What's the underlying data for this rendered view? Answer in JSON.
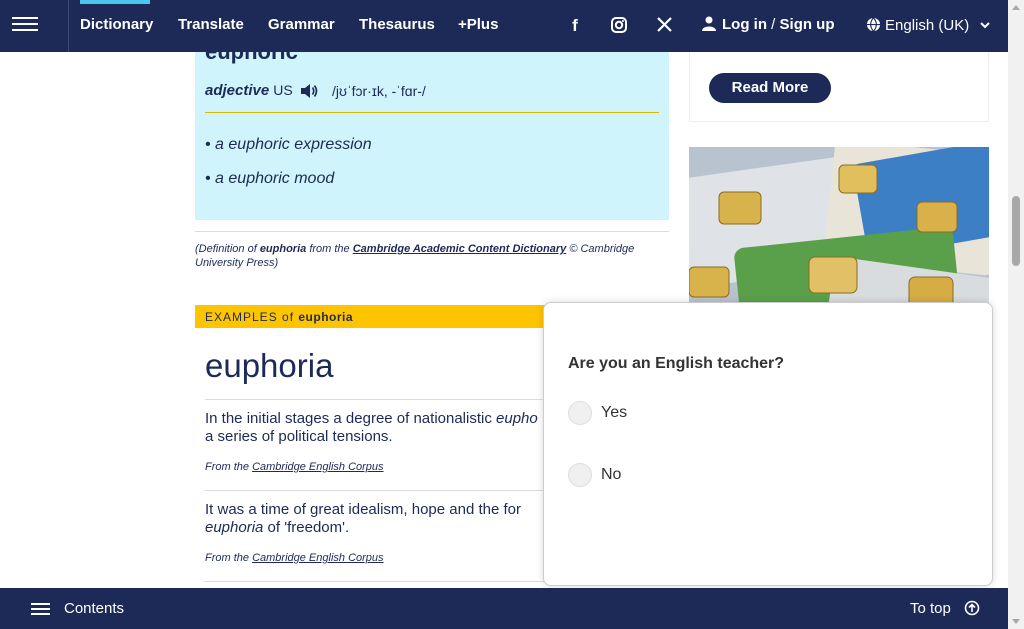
{
  "nav": {
    "items": [
      {
        "label": "Dictionary"
      },
      {
        "label": "Translate"
      },
      {
        "label": "Grammar"
      },
      {
        "label": "Thesaurus"
      },
      {
        "label": "+Plus"
      }
    ],
    "social": [
      "facebook-icon",
      "instagram-icon",
      "x-icon"
    ],
    "login_label": "Log in",
    "login_sep": "/",
    "signup_label": "Sign up",
    "language": "English (UK)"
  },
  "entry": {
    "headword": "euphoric",
    "pos": "adjective",
    "region": "US",
    "ipa": "/jʊˈfɔr·ɪk, -ˈfɑr-/",
    "examples": [
      {
        "prefix": "a euphoric ",
        "link": "expression"
      },
      {
        "prefix": "a euphoric ",
        "link": "mood"
      }
    ],
    "citation": {
      "pre": "(Definition of ",
      "word": "euphoria",
      "mid": " from the ",
      "source": "Cambridge Academic Content Dictionary",
      "post": " © Cambridge University Press)"
    }
  },
  "examples_section": {
    "band_label": "EXAMPLES of ",
    "band_word": "euphoria",
    "title": "euphoria",
    "items": [
      {
        "pre": "In the initial stages a degree of nationalistic ",
        "em": "eupho",
        "post": " a series of political tensions.",
        "from": "From the ",
        "source": "Cambridge English Corpus"
      },
      {
        "pre": "It was a time of great idealism, hope and the for",
        "em": "euphoria",
        "post": " of 'freedom'.",
        "from": "From the ",
        "source": "Cambridge English Corpus"
      }
    ]
  },
  "sidebar": {
    "read_more": "Read More"
  },
  "survey": {
    "question": "Are you an English teacher?",
    "options": [
      "Yes",
      "No"
    ]
  },
  "bottom": {
    "contents": "Contents",
    "to_top": "To top"
  },
  "colors": {
    "brand_navy": "#1d2a57",
    "definition_bg": "#d0f4fb",
    "examples_band": "#fec400",
    "accent_cyan": "#4bc6f0"
  }
}
